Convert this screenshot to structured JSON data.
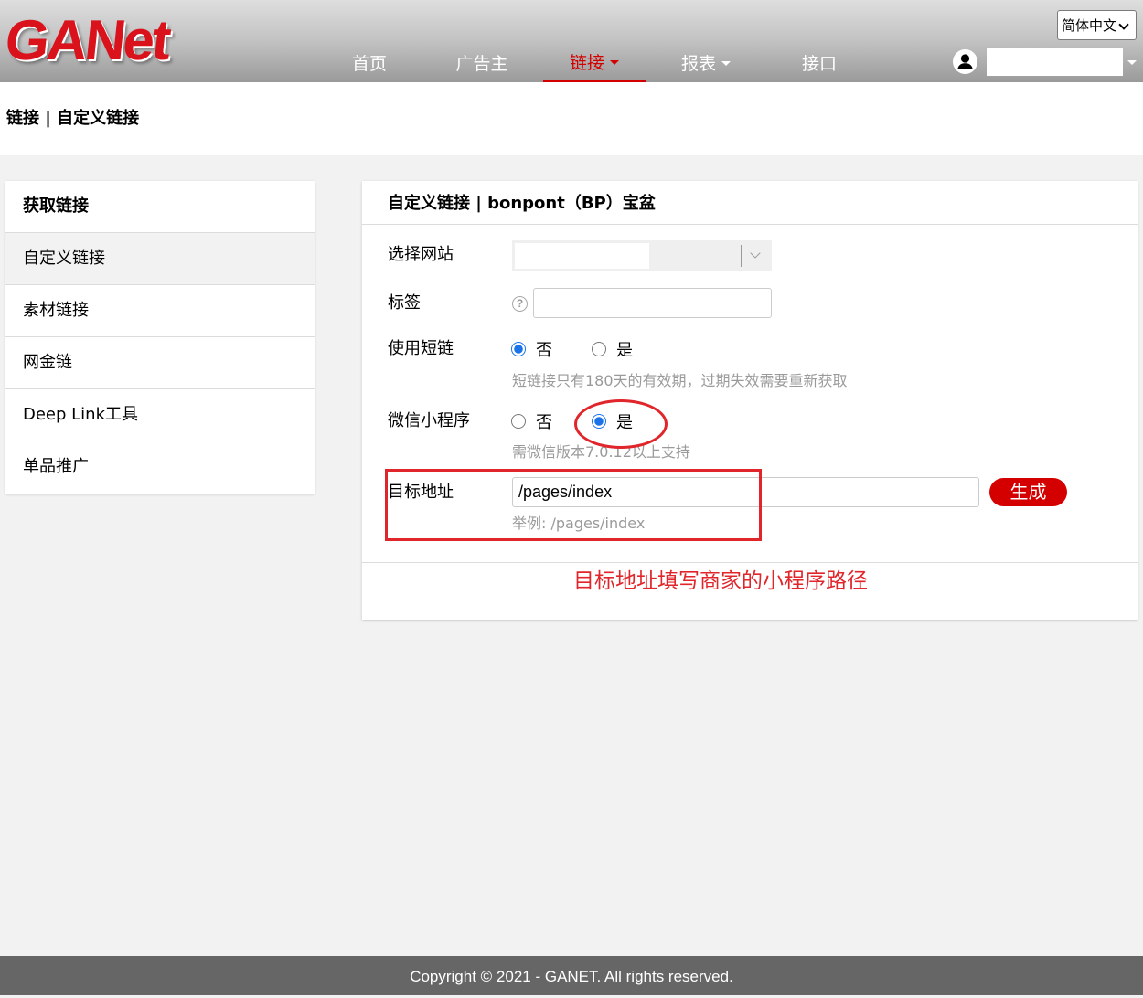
{
  "colors": {
    "accent": "#d40000",
    "annotation": "#e0262b",
    "radio": "#1a73e8",
    "header_top": "#dedede",
    "header_bottom": "#9a9a9a",
    "footer": "#666666"
  },
  "icons": {
    "user": "user-icon",
    "help": "help-icon",
    "select_chevron": "chevron-down-icon",
    "nav_caret": "caret-down-icon"
  },
  "header": {
    "logo": "GANet",
    "nav": [
      {
        "label": "首页",
        "active": false,
        "dropdown": false
      },
      {
        "label": "广告主",
        "active": false,
        "dropdown": false
      },
      {
        "label": "链接",
        "active": true,
        "dropdown": true
      },
      {
        "label": "报表",
        "active": false,
        "dropdown": true
      },
      {
        "label": "接口",
        "active": false,
        "dropdown": false
      }
    ],
    "language": "简体中文",
    "user_name": ""
  },
  "breadcrumb": "链接 | 自定义链接",
  "sidebar": {
    "title": "获取链接",
    "items": [
      {
        "label": "自定义链接",
        "active": true
      },
      {
        "label": "素材链接",
        "active": false
      },
      {
        "label": "网金链",
        "active": false
      },
      {
        "label": "Deep Link工具",
        "active": false
      },
      {
        "label": "单品推广",
        "active": false
      }
    ]
  },
  "main": {
    "title": "自定义链接 | bonpont（BP）宝盆",
    "form": {
      "site": {
        "label": "选择网站",
        "value": ""
      },
      "tag": {
        "label": "标签",
        "value": ""
      },
      "short_link": {
        "label": "使用短链",
        "options": [
          {
            "label": "否",
            "checked": true
          },
          {
            "label": "是",
            "checked": false
          }
        ],
        "hint": "短链接只有180天的有效期，过期失效需要重新获取"
      },
      "mini_program": {
        "label": "微信小程序",
        "options": [
          {
            "label": "否",
            "checked": false
          },
          {
            "label": "是",
            "checked": true
          }
        ],
        "hint": "需微信版本7.0.12以上支持"
      },
      "target": {
        "label": "目标地址",
        "value": "/pages/index",
        "hint": "举例: /pages/index",
        "button": "生成"
      }
    },
    "annotation": "目标地址填写商家的小程序路径"
  },
  "footer": "Copyright © 2021 - GANET. All rights reserved."
}
